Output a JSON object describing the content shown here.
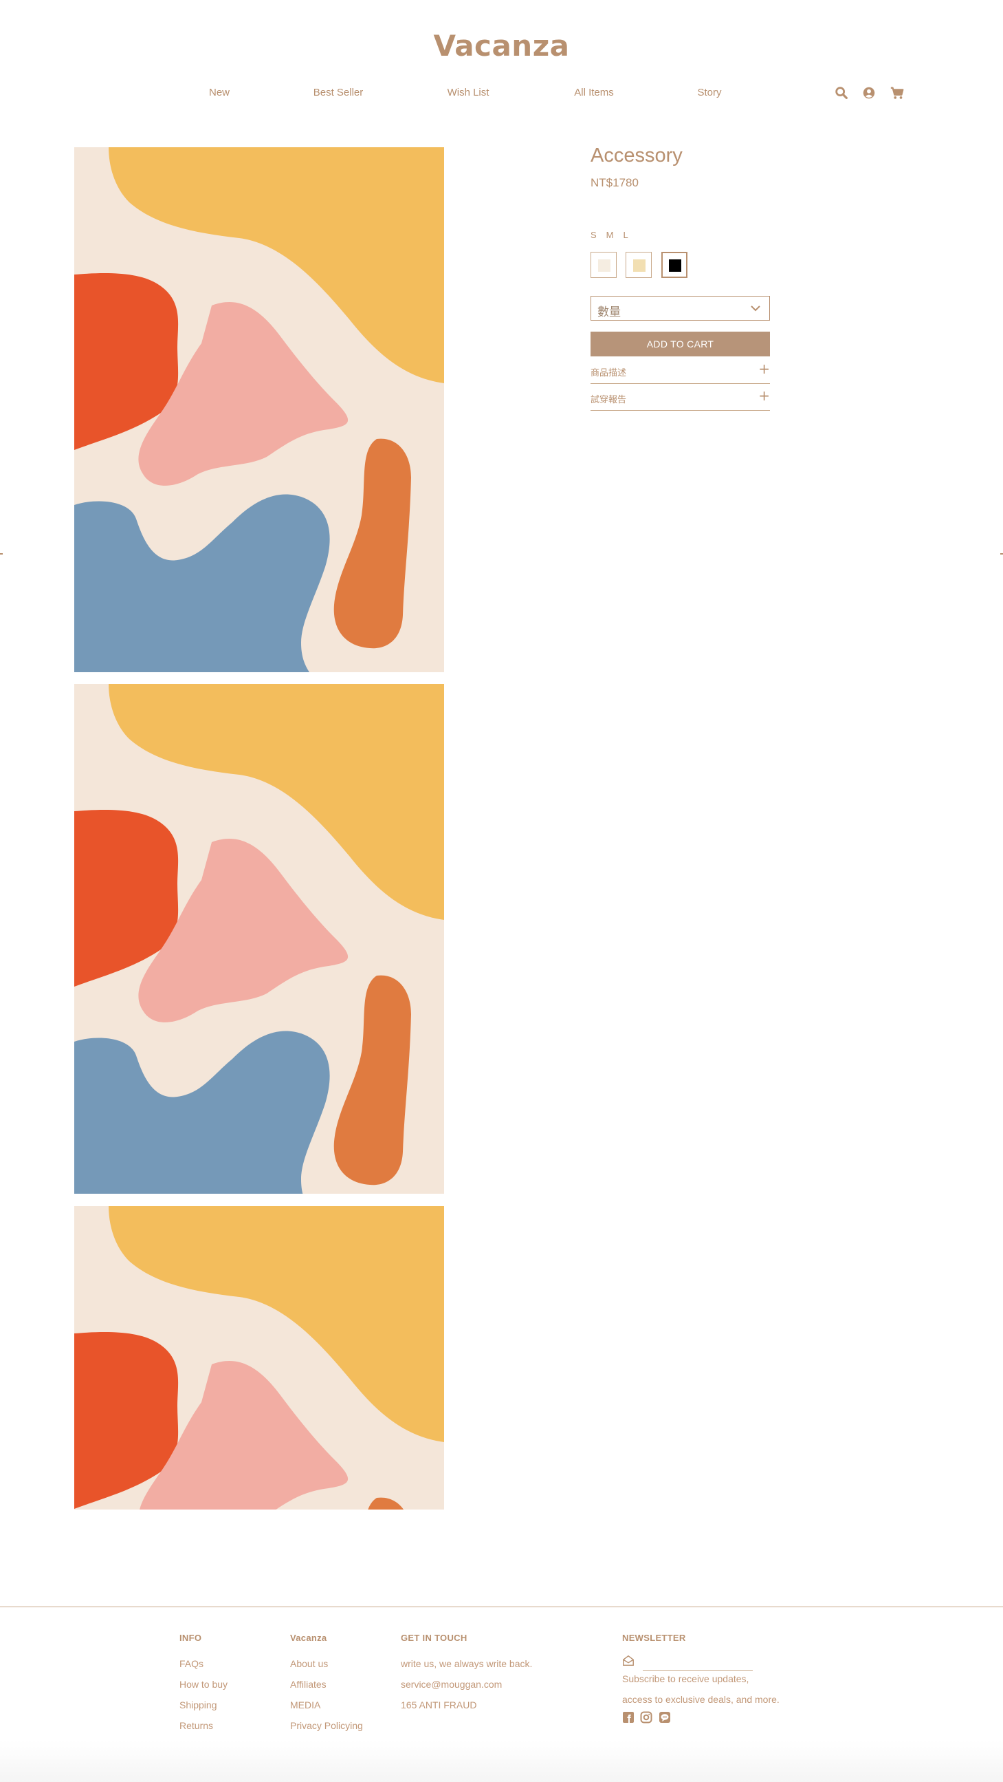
{
  "brand": {
    "logo": "Vacanza"
  },
  "nav": {
    "items": [
      "New",
      "Best Seller",
      "Wish List",
      "All Items",
      "Story"
    ],
    "icons": [
      "search-icon",
      "user-icon",
      "cart-icon"
    ]
  },
  "product": {
    "title": "Accessory",
    "price": "NT$1780",
    "sizes": [
      "S",
      "M",
      "L"
    ],
    "colors": [
      {
        "hex": "#f5ede1",
        "selected": false
      },
      {
        "hex": "#f2dfb2",
        "selected": false
      },
      {
        "hex": "#000000",
        "selected": true
      }
    ],
    "quantity_placeholder": "數量",
    "add_to_cart": "ADD TO CART",
    "accordions": [
      {
        "label": "商品描述",
        "icon": "+"
      },
      {
        "label": "試穿報告",
        "icon": "+"
      }
    ],
    "image_count": 3
  },
  "footer": {
    "info": {
      "heading": "INFO",
      "links": [
        "FAQs",
        "How to buy",
        "Shipping",
        "Returns"
      ]
    },
    "brand": {
      "heading": "Vacanza",
      "links": [
        "About us",
        "Affiliates",
        "MEDIA",
        "Privacy Policying"
      ]
    },
    "contact": {
      "heading": "GET IN TOUCH",
      "lines": [
        "write us, we always write back.",
        "service@mouggan.com",
        "165 ANTI FRAUD"
      ]
    },
    "newsletter": {
      "heading": "NEWSLETTER",
      "input_placeholder": "",
      "lines": [
        "Subscribe to receive updates,",
        "access to exclusive deals, and more."
      ],
      "social_icons": [
        "facebook-icon",
        "instagram-icon",
        "line-icon"
      ]
    }
  },
  "colors": {
    "accent": "#b8906f",
    "button": "#b79479",
    "art_bg": "#f4e6d9",
    "art_yellow": "#f3bd5c",
    "art_red": "#e8542a",
    "art_pink": "#f2ada3",
    "art_blue": "#7599b8",
    "art_orange": "#e07b40"
  }
}
